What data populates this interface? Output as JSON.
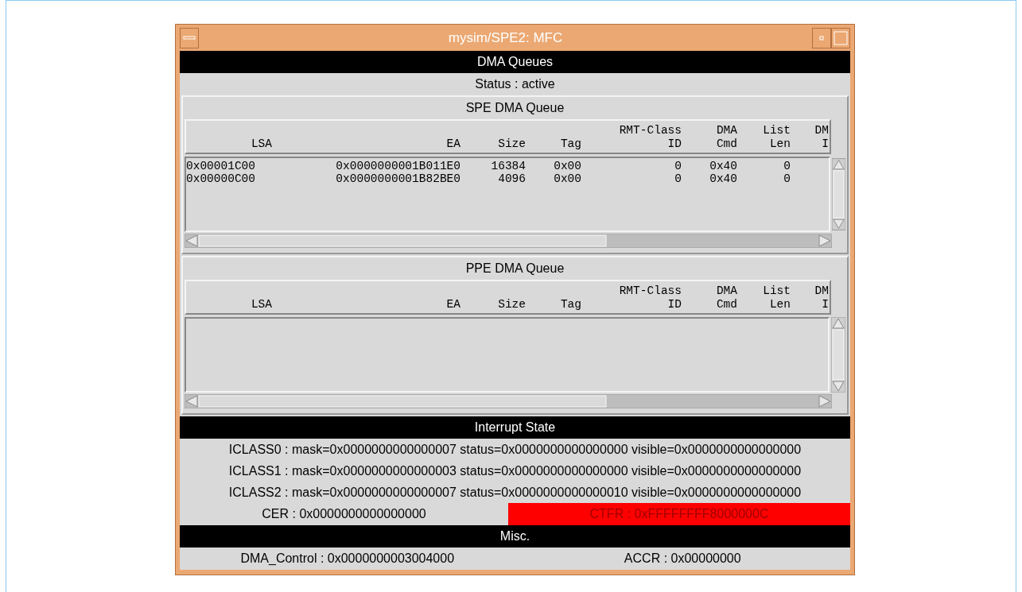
{
  "window": {
    "title": "mysim/SPE2: MFC"
  },
  "dma_header": "DMA Queues",
  "status": "Status : active",
  "queues": [
    {
      "title": "SPE DMA Queue",
      "columns": [
        {
          "lines": [
            "LSA"
          ]
        },
        {
          "lines": [
            "EA"
          ]
        },
        {
          "lines": [
            "Size"
          ]
        },
        {
          "lines": [
            "Tag"
          ]
        },
        {
          "lines": [
            "RMT-Class",
            "ID"
          ]
        },
        {
          "lines": [
            "DMA",
            "Cmd"
          ]
        },
        {
          "lines": [
            "List",
            "Len"
          ]
        },
        {
          "lines": [
            "DM",
            "I"
          ]
        }
      ],
      "rows": [
        [
          "0x00001C00",
          "0x0000000001B011E0",
          "16384",
          "0x00",
          "0",
          "0x40",
          "0"
        ],
        [
          "0x00000C00",
          "0x0000000001B82BE0",
          "4096",
          "0x00",
          "0",
          "0x40",
          "0"
        ]
      ]
    },
    {
      "title": "PPE DMA Queue",
      "columns": [
        {
          "lines": [
            "LSA"
          ]
        },
        {
          "lines": [
            "EA"
          ]
        },
        {
          "lines": [
            "Size"
          ]
        },
        {
          "lines": [
            "Tag"
          ]
        },
        {
          "lines": [
            "RMT-Class",
            "ID"
          ]
        },
        {
          "lines": [
            "DMA",
            "Cmd"
          ]
        },
        {
          "lines": [
            "List",
            "Len"
          ]
        },
        {
          "lines": [
            "DM",
            "I"
          ]
        }
      ]
    }
  ],
  "interrupt_header": "Interrupt State",
  "interrupt_rows": [
    "ICLASS0 : mask=0x0000000000000007 status=0x0000000000000000 visible=0x0000000000000000",
    "ICLASS1 : mask=0x0000000000000003 status=0x0000000000000000 visible=0x0000000000000000",
    "ICLASS2 : mask=0x0000000000000007 status=0x0000000000000010 visible=0x0000000000000000"
  ],
  "registers": [
    {
      "text": "CER : 0x0000000000000000",
      "alert": false
    },
    {
      "text": "CTFR : 0xFFFFFFFF8000000C",
      "alert": true
    }
  ],
  "misc_header": "Misc.",
  "misc": [
    {
      "text": "DMA_Control : 0x0000000003004000"
    },
    {
      "text": "ACCR : 0x00000000"
    }
  ]
}
